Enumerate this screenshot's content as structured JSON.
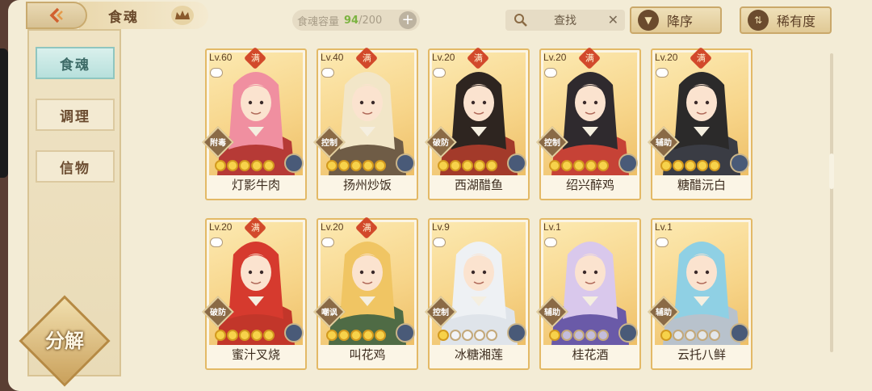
{
  "header": {
    "title": "食魂",
    "capacity_label": "食魂容量",
    "capacity_current": "94",
    "capacity_max": "/200",
    "search_placeholder": "查找",
    "sort_desc_label": "降序",
    "sort_rarity_label": "稀有度"
  },
  "sidebar": {
    "tabs": [
      {
        "label": "食魂"
      },
      {
        "label": "调理"
      },
      {
        "label": "信物"
      }
    ],
    "decompose_label": "分解"
  },
  "full_badge": "满",
  "cards": [
    {
      "level": "Lv.60",
      "name": "灯影牛肉",
      "role": "附毒",
      "stars": 5,
      "full": true,
      "hair": "#f08fa0",
      "robe": "#b63a36"
    },
    {
      "level": "Lv.40",
      "name": "扬州炒饭",
      "role": "控制",
      "stars": 5,
      "full": true,
      "hair": "#f2e6c8",
      "robe": "#6f5c46"
    },
    {
      "level": "Lv.20",
      "name": "西湖醋鱼",
      "role": "破防",
      "stars": 5,
      "full": true,
      "hair": "#2e2520",
      "robe": "#a33a2a"
    },
    {
      "level": "Lv.20",
      "name": "绍兴醉鸡",
      "role": "控制",
      "stars": 5,
      "full": true,
      "hair": "#2f2a2e",
      "robe": "#c64236"
    },
    {
      "level": "Lv.20",
      "name": "糖醋沅白",
      "role": "辅助",
      "stars": 5,
      "full": true,
      "hair": "#2b2a2a",
      "robe": "#3a3c44"
    },
    {
      "level": "Lv.20",
      "name": "蜜汁叉烧",
      "role": "破防",
      "stars": 5,
      "full": true,
      "hair": "#d63a2e",
      "robe": "#c2362a"
    },
    {
      "level": "Lv.20",
      "name": "叫花鸡",
      "role": "嘲讽",
      "stars": 5,
      "full": true,
      "hair": "#f0c563",
      "robe": "#4f6b45"
    },
    {
      "level": "Lv.9",
      "name": "冰糖湘莲",
      "role": "控制",
      "stars": 1,
      "full": false,
      "hair": "#eef1f4",
      "robe": "#dfe4ea"
    },
    {
      "level": "Lv.1",
      "name": "桂花酒",
      "role": "辅助",
      "stars": 1,
      "full": false,
      "hair": "#d9c8ec",
      "robe": "#6a5aa8"
    },
    {
      "level": "Lv.1",
      "name": "云托八鲜",
      "role": "辅助",
      "stars": 1,
      "full": false,
      "hair": "#8fd0e4",
      "robe": "#b8c2cc"
    }
  ],
  "colors": {
    "accent": "#e3b966",
    "active_tab": "#b7e0dc",
    "capacity_current": "#7cb341"
  },
  "icons": [
    "back-arrow-icon",
    "crown-icon",
    "plus-icon",
    "search-icon",
    "close-icon",
    "sort-desc-icon",
    "rarity-icon"
  ]
}
